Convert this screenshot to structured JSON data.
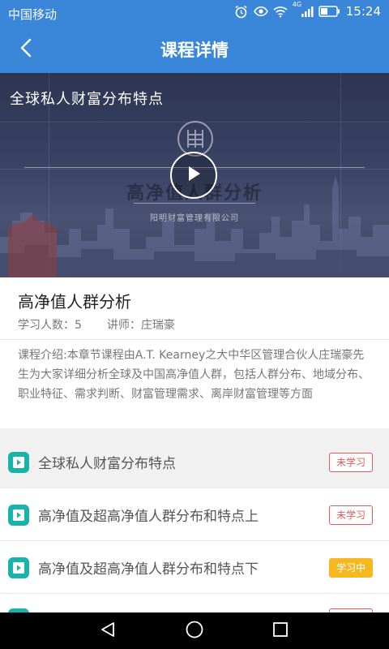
{
  "status_bar": {
    "carrier": "中国移动",
    "network": "4G",
    "time": "15:24",
    "icons": [
      "alarm-icon",
      "eye-icon",
      "wifi-icon",
      "signal-icon",
      "battery-icon"
    ]
  },
  "header": {
    "title": "课程详情",
    "bg_color": "#3a86d9"
  },
  "video": {
    "title": "全球私人财富分布特点",
    "watermark_title": "高净值人群分析",
    "watermark_company": "阳明财富管理有限公司"
  },
  "course": {
    "name": "高净值人群分析",
    "learners_label": "学习人数：",
    "learners_count": "5",
    "lecturer_label": "讲师：",
    "lecturer": "庄瑞豪",
    "intro": "课程介绍:本章节课程由A.T. Kearney之大中华区管理合伙人庄瑞豪先生为大家详细分析全球及中国高净值人群，包括人群分布、地域分布、职业特征、需求判断、财富管理需求、离岸财富管理等方面"
  },
  "lessons": [
    {
      "title": "全球私人财富分布特点",
      "status": "未学习",
      "state": "unstudied",
      "active": true
    },
    {
      "title": "高净值及超高净值人群分布和特点上",
      "status": "未学习",
      "state": "unstudied",
      "active": false
    },
    {
      "title": "高净值及超高净值人群分布和特点下",
      "status": "学习中",
      "state": "studying",
      "active": false
    }
  ],
  "colors": {
    "accent": "#3a86d9",
    "lesson_icon": "#19b3a9",
    "badge_unstudied": "#e25a5a",
    "badge_studying": "#f7b721"
  }
}
